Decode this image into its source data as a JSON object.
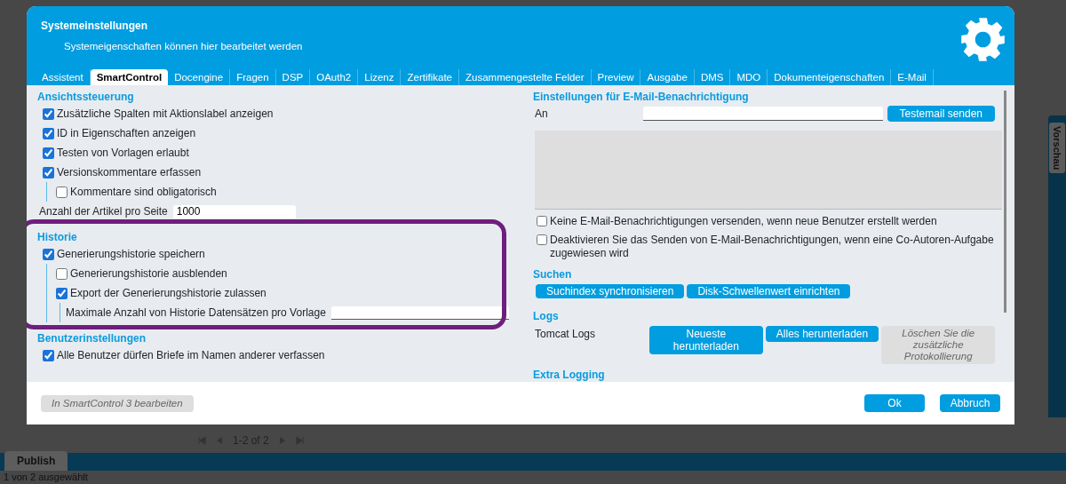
{
  "dialog": {
    "title": "Systemeinstellungen",
    "subtitle": "Systemeigenschaften können hier bearbeitet werden"
  },
  "tabs": [
    {
      "label": "Assistent",
      "selected": false
    },
    {
      "label": "SmartControl",
      "selected": true
    },
    {
      "label": "Docengine",
      "selected": false
    },
    {
      "label": "Fragen",
      "selected": false
    },
    {
      "label": "DSP",
      "selected": false
    },
    {
      "label": "OAuth2",
      "selected": false
    },
    {
      "label": "Lizenz",
      "selected": false
    },
    {
      "label": "Zertifikate",
      "selected": false
    },
    {
      "label": "Zusammengestelte Felder",
      "selected": false
    },
    {
      "label": "Preview",
      "selected": false
    },
    {
      "label": "Ausgabe",
      "selected": false
    },
    {
      "label": "DMS",
      "selected": false
    },
    {
      "label": "MDO",
      "selected": false
    },
    {
      "label": "Dokumenteigenschaften",
      "selected": false
    },
    {
      "label": "E-Mail",
      "selected": false
    }
  ],
  "left_sections": [
    {
      "title": "Ansichtssteuerung",
      "highlighted": false,
      "items": [
        {
          "kind": "checkbox",
          "label": "Zusätzliche Spalten mit Aktionslabel anzeigen",
          "checked": true
        },
        {
          "kind": "checkbox",
          "label": "ID in Eigenschaften anzeigen",
          "checked": true
        },
        {
          "kind": "checkbox",
          "label": "Testen von Vorlagen erlaubt",
          "checked": true
        },
        {
          "kind": "checkbox",
          "label": "Versionskommentare erfassen",
          "checked": true,
          "children": [
            {
              "kind": "checkbox",
              "label": "Kommentare sind obligatorisch",
              "checked": false
            }
          ]
        },
        {
          "kind": "field",
          "label": "Anzahl der Artikel pro Seite",
          "value": "1000"
        }
      ]
    },
    {
      "title": "Historie",
      "highlighted": true,
      "items": [
        {
          "kind": "checkbox",
          "label": "Generierungshistorie speichern",
          "checked": true,
          "children": [
            {
              "kind": "checkbox",
              "label": "Generierungshistorie ausblenden",
              "checked": false
            },
            {
              "kind": "checkbox",
              "label": "Export der Generierungshistorie zulassen",
              "checked": true,
              "children": [
                {
                  "kind": "field",
                  "label": "Maximale Anzahl von Historie Datensätzen pro Vorlage"
                }
              ]
            }
          ]
        }
      ]
    },
    {
      "title": "Benutzerinstellungen",
      "highlighted": false,
      "items": [
        {
          "kind": "checkbox",
          "label": "Alle Benutzer dürfen Briefe im Namen anderer verfassen",
          "checked": true
        }
      ]
    }
  ],
  "email": {
    "title": "Einstellungen für E-Mail-Benachrichtigung",
    "to_label": "An",
    "test_button": "Testemail senden",
    "options": [
      {
        "label": "Keine E-Mail-Benachrichtigungen versenden, wenn neue Benutzer erstellt werden",
        "checked": false
      },
      {
        "label": "Deaktivieren Sie das Senden von E-Mail-Benachrichtigungen, wenn eine Co-Autoren-Aufgabe zugewiesen wird",
        "checked": false
      }
    ]
  },
  "search": {
    "title": "Suchen",
    "buttons": [
      {
        "label": "Suchindex synchronisieren",
        "disabled": false
      },
      {
        "label": "Disk-Schwellenwert einrichten",
        "disabled": false
      }
    ]
  },
  "logs": {
    "title": "Logs",
    "label": "Tomcat Logs",
    "buttons": [
      {
        "label": "Neueste herunterladen",
        "disabled": false
      },
      {
        "label": "Alles herunterladen",
        "disabled": false
      },
      {
        "label": "Löschen Sie die zusätzliche Protokollierung",
        "disabled": true
      }
    ]
  },
  "extra_logging": {
    "title": "Extra Logging"
  },
  "footer": {
    "edit_button": {
      "label": "In SmartControl 3 bearbeiten",
      "disabled": true
    },
    "buttons": [
      {
        "label": "Ok"
      },
      {
        "label": "Abbruch"
      }
    ]
  },
  "background": {
    "side_tab": "Vorschau",
    "pager": "1-2 of 2",
    "bottom_tab": "Publish",
    "status": "1 von 2 ausgewählt"
  }
}
